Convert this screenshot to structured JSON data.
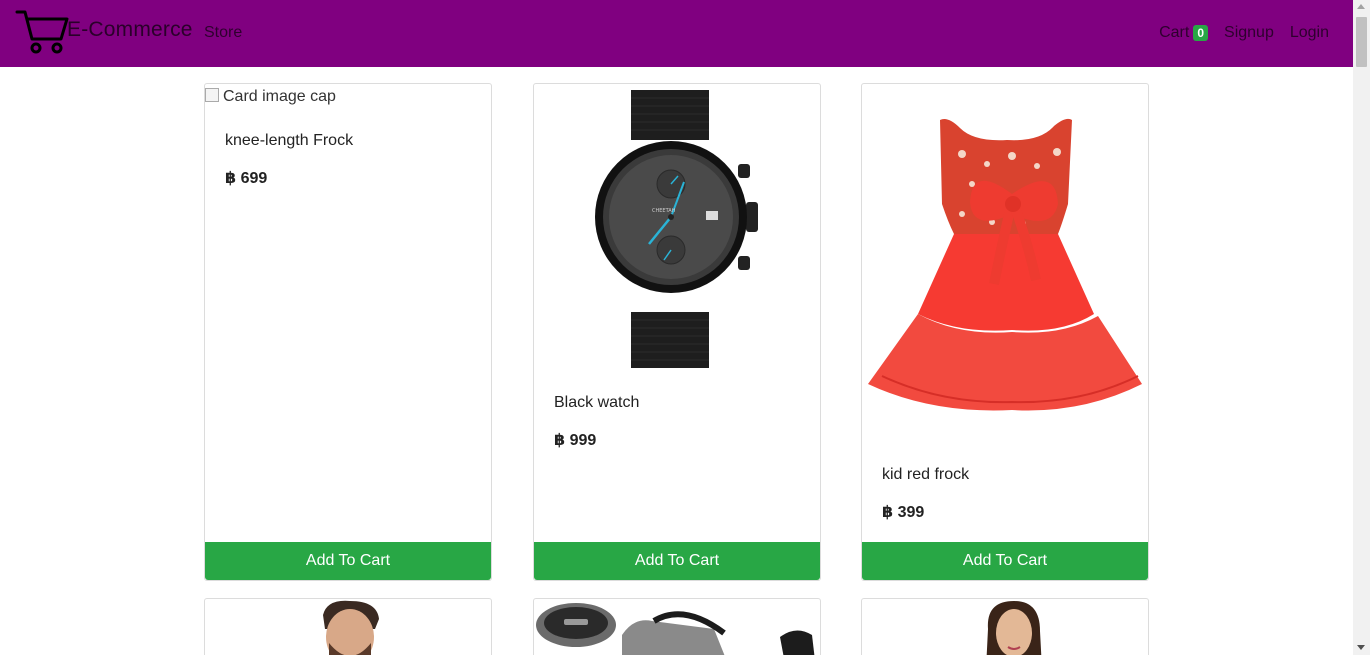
{
  "navbar": {
    "brand_icon": "shopping-cart-icon",
    "brand_text": "E-Commerce",
    "store_label": "Store",
    "cart_label": "Cart",
    "cart_count": "0",
    "signup_label": "Signup",
    "login_label": "Login",
    "background_color": "#800080"
  },
  "products": [
    {
      "alt": "Card image cap",
      "title": "knee-length Frock",
      "price": "฿ 699",
      "button": "Add To Cart"
    },
    {
      "image": "black-watch-image",
      "title": "Black watch",
      "price": "฿ 999",
      "button": "Add To Cart"
    },
    {
      "image": "red-frock-image",
      "title": "kid red frock",
      "price": "฿ 399",
      "button": "Add To Cart"
    }
  ],
  "products_row2": [
    {
      "image": "man-portrait-image"
    },
    {
      "image": "backpack-image"
    },
    {
      "image": "woman-portrait-image"
    }
  ],
  "colors": {
    "accent": "#28a745",
    "brand": "#800080"
  }
}
